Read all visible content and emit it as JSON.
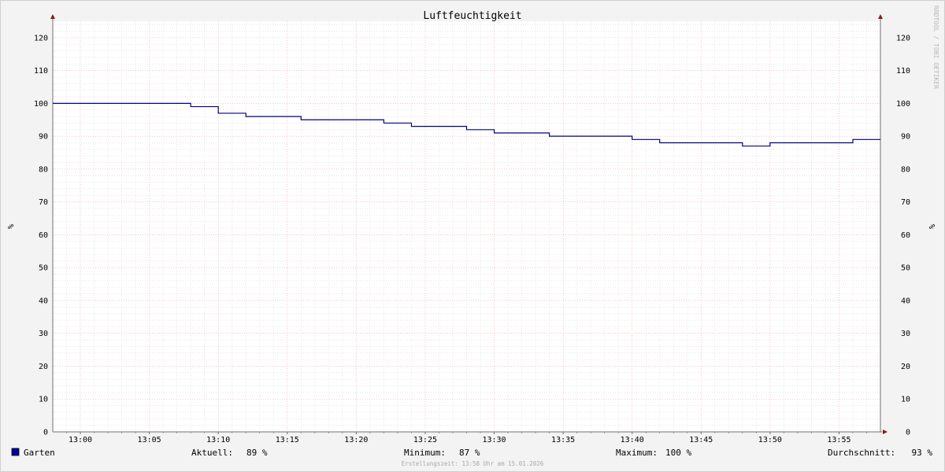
{
  "watermark": "RRDTOOL / TOBI OETIKER",
  "footer": {
    "legend_label": "Garten",
    "legend_color": "#0000a0",
    "stats": [
      {
        "label": "Aktuell:",
        "value": "89 %"
      },
      {
        "label": "Minimum:",
        "value": "87 %"
      },
      {
        "label": "Maximum:",
        "value": "100 %"
      },
      {
        "label": "Durchschnitt:",
        "value": "93 %"
      }
    ],
    "creation_time": "Erstellungszeit: 13:58 Uhr am 15.01.2026"
  },
  "colors": {
    "background": "#f3f3f3",
    "canvas": "#ffffff",
    "major_grid": "#f0a0a0",
    "minor_grid": "#d8d8d8",
    "axis": "#707070",
    "arrow": "#8b1a1a",
    "line": "#00007f"
  },
  "chart_data": {
    "type": "line",
    "title": "Luftfeuchtigkeit",
    "ylabel": "%",
    "ylabel_right": "%",
    "xlim": [
      "12:58",
      "13:58"
    ],
    "ylim": [
      0,
      125
    ],
    "y_ticks": [
      0,
      10,
      20,
      30,
      40,
      50,
      60,
      70,
      80,
      90,
      100,
      110,
      120
    ],
    "x_ticks": [
      "13:00",
      "13:05",
      "13:10",
      "13:15",
      "13:20",
      "13:25",
      "13:30",
      "13:35",
      "13:40",
      "13:45",
      "13:50",
      "13:55"
    ],
    "grid": true,
    "legend": "bottom-left",
    "series": [
      {
        "name": "Garten",
        "color": "#00007f",
        "step": true,
        "x": [
          "12:58",
          "13:08",
          "13:10",
          "13:12",
          "13:16",
          "13:22",
          "13:24",
          "13:28",
          "13:30",
          "13:34",
          "13:40",
          "13:42",
          "13:48",
          "13:50",
          "13:56",
          "13:58"
        ],
        "y": [
          100,
          99,
          97,
          96,
          95,
          94,
          93,
          92,
          91,
          90,
          89,
          88,
          87,
          88,
          89,
          89
        ]
      }
    ]
  }
}
